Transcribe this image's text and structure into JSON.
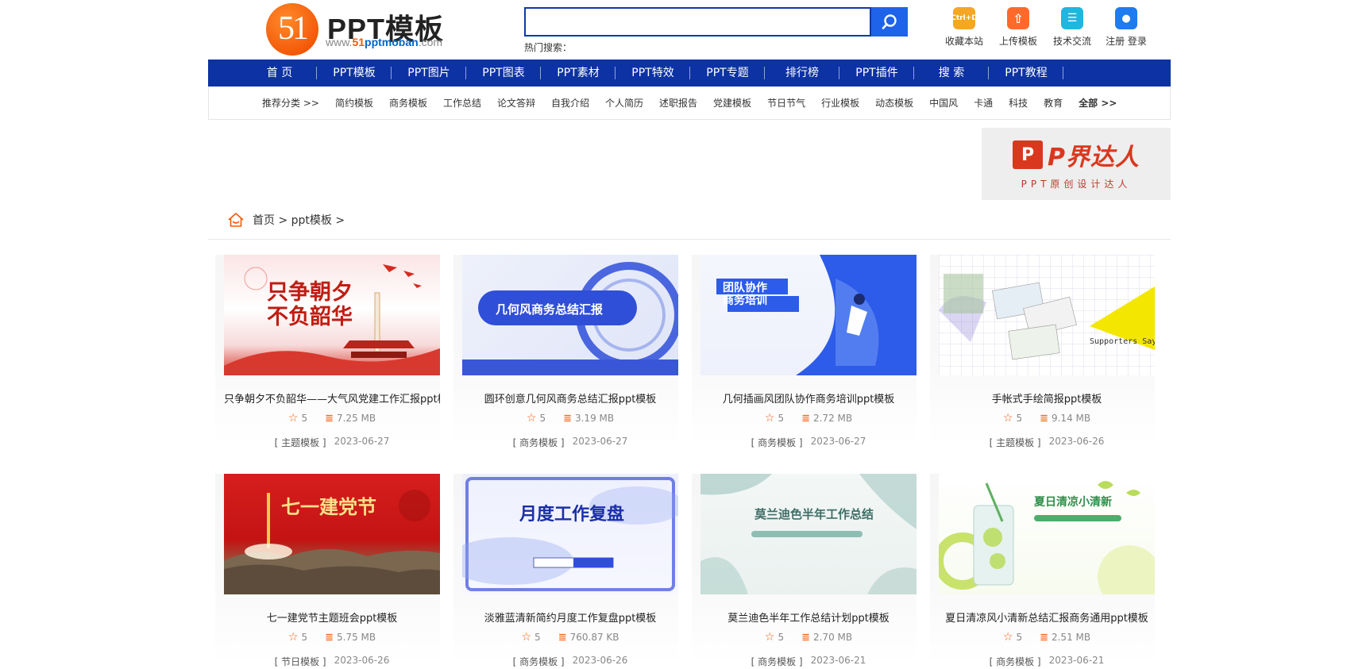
{
  "header": {
    "logo_text": "51",
    "brand_title": "PPT模板",
    "brand_url": {
      "prefix": "www.",
      "num": "51",
      "domain": "pptmoban",
      "suffix": ".com"
    },
    "search_placeholder": "",
    "hot_search_label": "热门搜索：",
    "tools": [
      {
        "label": "收藏本站",
        "icon": "bookmark-icon",
        "icon_text": "Ctrl+D",
        "color": "#f5a623"
      },
      {
        "label": "上传模板",
        "icon": "upload-icon",
        "icon_text": "⇧",
        "color": "#ff6a2a"
      },
      {
        "label": "技术交流",
        "icon": "chat-icon",
        "icon_text": "☰",
        "color": "#22b5e0"
      },
      {
        "label": "注册 登录",
        "icon": "user-icon",
        "icon_text": "●",
        "color": "#1e7bf0"
      }
    ]
  },
  "mainnav": [
    "首 页",
    "PPT模板",
    "PPT图片",
    "PPT图表",
    "PPT素材",
    "PPT特效",
    "PPT专题",
    "排行榜",
    "PPT插件",
    "搜 索",
    "PPT教程"
  ],
  "subnav": [
    "推荐分类 >>",
    "简约模板",
    "商务模板",
    "工作总结",
    "论文答辩",
    "自我介绍",
    "个人简历",
    "述职报告",
    "党建模板",
    "节日节气",
    "行业模板",
    "动态模板",
    "中国风",
    "卡通",
    "科技",
    "教育",
    "全部 >>"
  ],
  "banner": {
    "p": "P",
    "name": "P界达人",
    "sub": "PPT原创设计达人"
  },
  "breadcrumb": "首页 > ppt模板 >",
  "cards": [
    {
      "title": "只争朝夕不负韶华——大气风党建工作汇报ppt模板",
      "rating": "5",
      "size": "7.25 MB",
      "category": "[ 主题模板 ]",
      "date": "2023-06-27",
      "thumb_text": "只争朝夕\n不负韶华"
    },
    {
      "title": "圆环创意几何风商务总结汇报ppt模板",
      "rating": "5",
      "size": "3.19 MB",
      "category": "[ 商务模板 ]",
      "date": "2023-06-27",
      "thumb_text": "几何风商务总结汇报"
    },
    {
      "title": "几何插画风团队协作商务培训ppt模板",
      "rating": "5",
      "size": "2.72 MB",
      "category": "[ 商务模板 ]",
      "date": "2023-06-27",
      "thumb_text": "团队协作\n商务培训"
    },
    {
      "title": "手帐式手绘简报ppt模板",
      "rating": "5",
      "size": "9.14 MB",
      "category": "[ 主题模板 ]",
      "date": "2023-06-26",
      "thumb_text": "Supporters Say"
    },
    {
      "title": "七一建党节主题班会ppt模板",
      "rating": "5",
      "size": "5.75 MB",
      "category": "[ 节日模板 ]",
      "date": "2023-06-26",
      "thumb_text": "七一建党节"
    },
    {
      "title": "淡雅蓝清新简约月度工作复盘ppt模板",
      "rating": "5",
      "size": "760.87 KB",
      "category": "[ 商务模板 ]",
      "date": "2023-06-26",
      "thumb_text": "月度工作复盘"
    },
    {
      "title": "莫兰迪色半年工作总结计划ppt模板",
      "rating": "5",
      "size": "2.70 MB",
      "category": "[ 商务模板 ]",
      "date": "2023-06-21",
      "thumb_text": "莫兰迪色半年工作总结"
    },
    {
      "title": "夏日清凉风小清新总结汇报商务通用ppt模板",
      "rating": "5",
      "size": "2.51 MB",
      "category": "[ 商务模板 ]",
      "date": "2023-06-21",
      "thumb_text": "夏日清凉小清新"
    }
  ]
}
